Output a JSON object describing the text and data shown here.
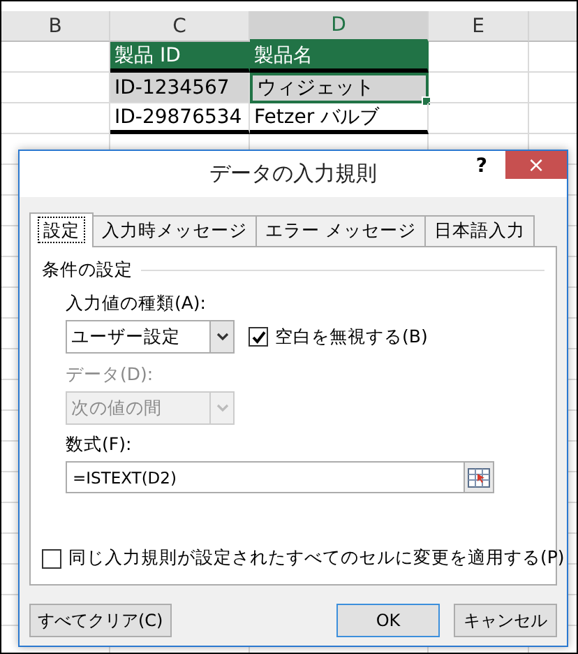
{
  "sheet": {
    "columns": [
      {
        "label": "B",
        "selected": false
      },
      {
        "label": "C",
        "selected": false
      },
      {
        "label": "D",
        "selected": true
      },
      {
        "label": "E",
        "selected": false
      }
    ],
    "table": {
      "header": [
        "製品 ID",
        "製品名"
      ],
      "rows": [
        {
          "selected": true,
          "cells": [
            {
              "text": "ID-1234567",
              "active": false
            },
            {
              "text": "ウィジェット",
              "active": true
            }
          ]
        },
        {
          "selected": false,
          "cells": [
            {
              "text": "ID-29876534",
              "active": false
            },
            {
              "text": "Fetzer バルブ",
              "active": false
            }
          ]
        }
      ]
    }
  },
  "dialog": {
    "title": "データの入力規則",
    "help": "?",
    "close": "×",
    "tabs": [
      {
        "label": "設定",
        "selected": true
      },
      {
        "label": "入力時メッセージ",
        "selected": false
      },
      {
        "label": "エラー メッセージ",
        "selected": false
      },
      {
        "label": "日本語入力",
        "selected": false
      }
    ],
    "group_title": "条件の設定",
    "allow": {
      "label": "入力値の種類(A):",
      "value": "ユーザー設定",
      "disabled": false
    },
    "ignore_blank": {
      "label": "空白を無視する(B)",
      "checked": true
    },
    "data": {
      "label": "データ(D):",
      "value": "次の値の間",
      "disabled": true
    },
    "formula": {
      "label": "数式(F):",
      "value": "=ISTEXT(D2)"
    },
    "apply_all": {
      "label": "同じ入力規則が設定されたすべてのセルに変更を適用する(P)",
      "checked": false
    },
    "buttons": [
      {
        "label": "すべてクリア(C)",
        "kind": "clear"
      },
      {
        "label": "OK",
        "kind": "default"
      },
      {
        "label": "キャンセル",
        "kind": "cancel"
      }
    ]
  }
}
